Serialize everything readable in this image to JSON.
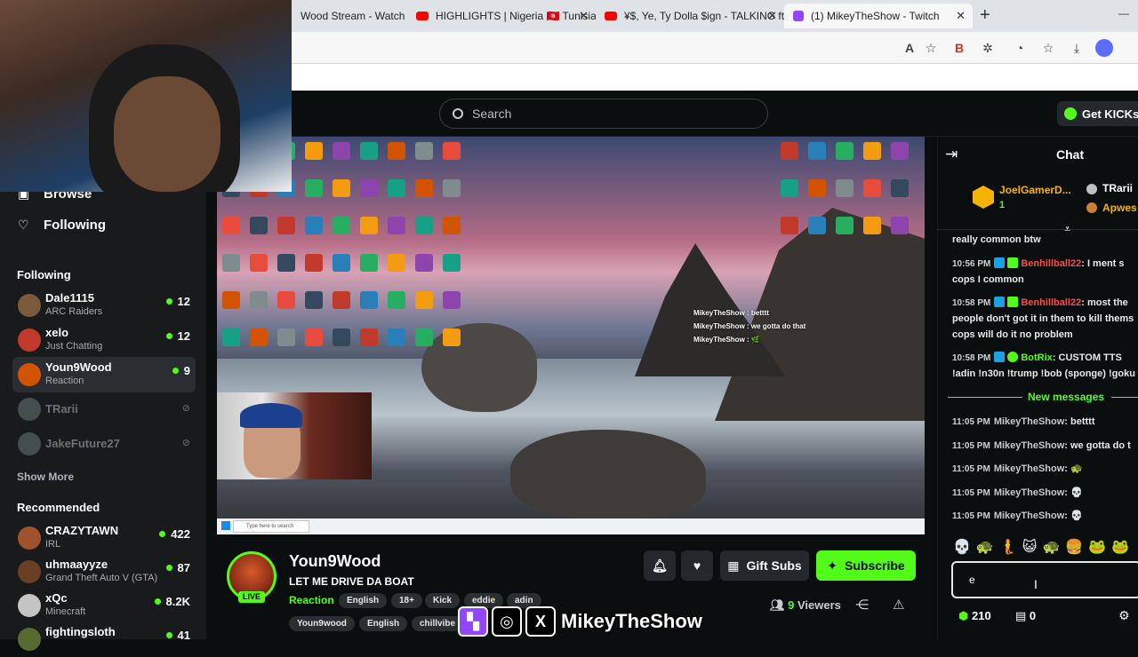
{
  "browser": {
    "tabs": [
      {
        "label": "Wood Stream - Watch L",
        "fav_color": "#ffffff",
        "active": false
      },
      {
        "label": "HIGHLIGHTS | Nigeria 🇹🇳 Tunisia |",
        "fav_color": "#ff0000",
        "active": false
      },
      {
        "label": "¥$, Ye, Ty Dolla $ign - TALKING ft.",
        "fav_color": "#ff0000",
        "active": false
      },
      {
        "label": "(1) MikeyTheShow - Twitch",
        "fav_color": "#9146ff",
        "active": true
      }
    ],
    "new_tab": "+",
    "minimize": "—",
    "read_aloud": "A"
  },
  "kick_header": {
    "search_placeholder": "Search",
    "get_kicks": "Get KICKs"
  },
  "sidebar": {
    "nav": [
      {
        "label": "Browse",
        "icon": "compass-icon"
      },
      {
        "label": "Following",
        "icon": "heart-icon"
      }
    ],
    "following_heading": "Following",
    "following": [
      {
        "name": "Dale1115",
        "category": "ARC Raiders",
        "viewers": "12",
        "color": "#7a5a3a",
        "online": true
      },
      {
        "name": "xelo",
        "category": "Just Chatting",
        "viewers": "12",
        "color": "#c0392b",
        "online": true
      },
      {
        "name": "Youn9Wood",
        "category": "Reaction",
        "viewers": "9",
        "color": "#d35400",
        "online": true
      },
      {
        "name": "TRarii",
        "category": "",
        "viewers": "",
        "color": "#7f8c8d",
        "online": false
      },
      {
        "name": "JakeFuture27",
        "category": "",
        "viewers": "",
        "color": "#7f8c8d",
        "online": false
      }
    ],
    "show_more": "Show More",
    "recommended_heading": "Recommended",
    "recommended": [
      {
        "name": "CRAZYTAWN",
        "category": "IRL",
        "viewers": "422",
        "color": "#a0522d",
        "online": true
      },
      {
        "name": "uhmaayyze",
        "category": "Grand Theft Auto V (GTA)",
        "viewers": "87",
        "color": "#6b3e26",
        "online": true
      },
      {
        "name": "xQc",
        "category": "Minecraft",
        "viewers": "8.2K",
        "color": "#c4c4c4",
        "online": true
      },
      {
        "name": "fightingsloth",
        "category": "",
        "viewers": "41",
        "color": "#556b2f",
        "online": true
      }
    ]
  },
  "video_overlay": {
    "chat_lines": [
      "MikeyTheShow : betttt",
      "MikeyTheShow : we gotta do that",
      "MikeyTheShow : 🌿"
    ],
    "taskbar_search": "Type here to search"
  },
  "stream": {
    "name": "Youn9Wood",
    "title": "LET ME DRIVE DA BOAT",
    "category": "Reaction",
    "live": "LIVE",
    "tags_row1": [
      "English",
      "18+",
      "Kick",
      "eddie",
      "adin"
    ],
    "tags_row2": [
      "Youn9wood",
      "English",
      "chillvibe"
    ],
    "gift_subs": "Gift Subs",
    "subscribe": "Subscribe",
    "viewers_count": "9",
    "viewers_label": "Viewers"
  },
  "chat": {
    "title": "Chat",
    "pinned": {
      "user1": "JoelGamerD...",
      "user1_count": "1",
      "user2": "TRarii",
      "user3": "Apwes"
    },
    "partial": "really common btw",
    "messages": [
      {
        "time": "10:56 PM",
        "user": "Benhillball22",
        "text": ": I ment s",
        "cont": "cops I common",
        "style": "red"
      },
      {
        "time": "10:58 PM",
        "user": "Benhillball22",
        "text": ": most the",
        "cont": "people don't got it in them to kill thems",
        "cont2": "cops will do it no problem",
        "style": "red"
      },
      {
        "time": "10:58 PM",
        "user": "BotRix",
        "text": ": CUSTOM TTS",
        "cont": "!adin !n30n !trump !bob (sponge) !goku",
        "style": "green"
      }
    ],
    "new_messages": "New messages",
    "recent": [
      {
        "time": "11:05 PM",
        "user": "MikeyTheShow",
        "text": ": betttt"
      },
      {
        "time": "11:05 PM",
        "user": "MikeyTheShow",
        "text": ": we gotta do t"
      },
      {
        "time": "11:05 PM",
        "user": "MikeyTheShow",
        "text": ": 🐢"
      },
      {
        "time": "11:05 PM",
        "user": "MikeyTheShow",
        "text": ": 💀"
      },
      {
        "time": "11:05 PM",
        "user": "MikeyTheShow",
        "text": ": 💀"
      }
    ],
    "emotes": "💀🐢🧜😺🐢🍔🐸🐸",
    "input_value": "e",
    "points": "210",
    "kicks": "0"
  },
  "social_overlay": {
    "name": "MikeyTheShow"
  },
  "colors": {
    "kick_green": "#53fc18",
    "bg": "#0b0e0f",
    "sidebar": "#181a1c"
  }
}
